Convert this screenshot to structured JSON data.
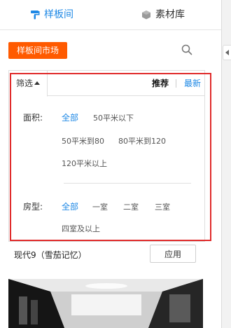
{
  "tabs": {
    "templates": "样板间",
    "materials": "素材库"
  },
  "toolbar": {
    "market_label": "样板间市场"
  },
  "filter": {
    "toggle_label": "筛选",
    "sort_recommend": "推荐",
    "sort_latest": "最新",
    "area": {
      "label": "面积:",
      "options": [
        "全部",
        "50平米以下",
        "50平米到80",
        "80平米到120",
        "120平米以上"
      ],
      "selected": "全部"
    },
    "rooms": {
      "label": "房型:",
      "options": [
        "全部",
        "一室",
        "二室",
        "三室",
        "四室及以上"
      ],
      "selected": "全部"
    }
  },
  "template": {
    "name": "现代9（雪茄记忆）",
    "apply_label": "应用"
  },
  "colors": {
    "accent": "#1e88e5",
    "market_button": "#ff5a00",
    "highlight_border": "#e02b2b"
  },
  "icons": [
    "brush-icon",
    "cube-icon",
    "search-icon",
    "caret-up-icon",
    "chevron-left-icon"
  ]
}
